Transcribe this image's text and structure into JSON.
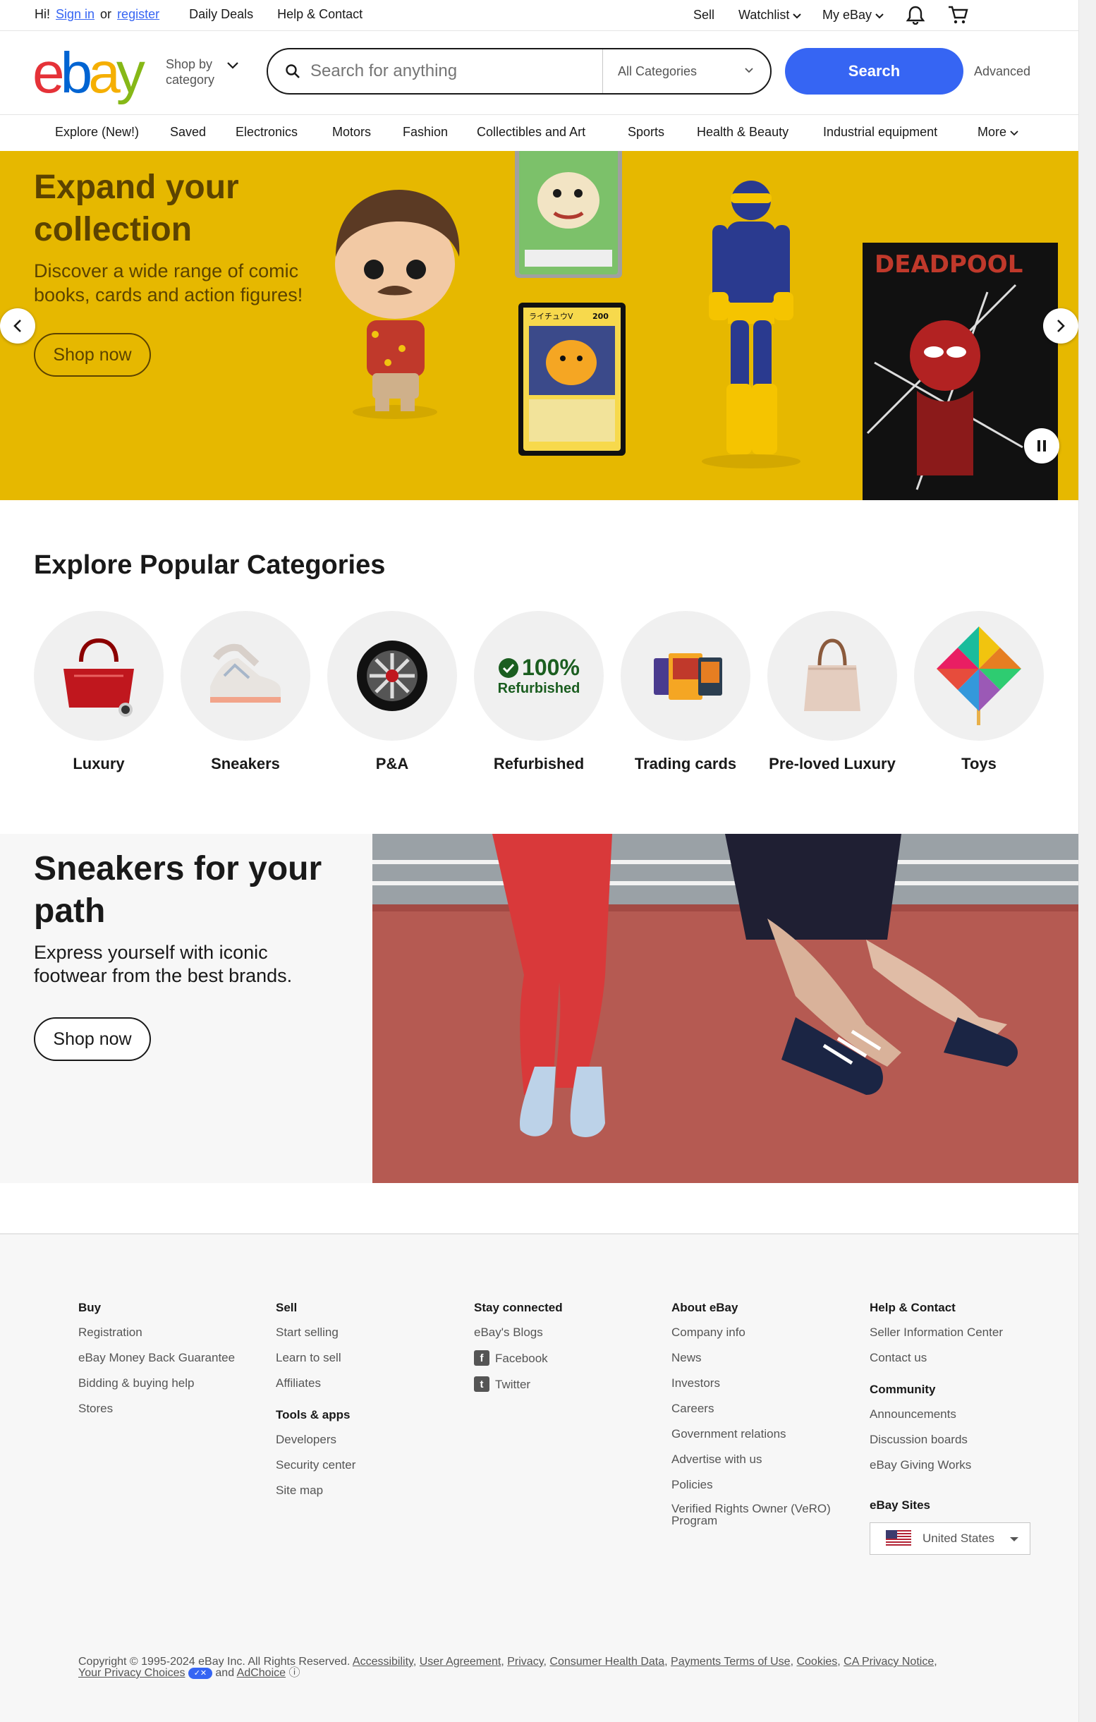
{
  "topbar": {
    "greeting": "Hi!",
    "sign_in": "Sign in",
    "or": "or",
    "register": "register",
    "daily_deals": "Daily Deals",
    "help_contact": "Help & Contact",
    "sell": "Sell",
    "watchlist": "Watchlist",
    "my_ebay": "My eBay",
    "notification_icon": "bell-icon",
    "cart_icon": "cart-icon"
  },
  "header": {
    "logo_letters": [
      "e",
      "b",
      "a",
      "y"
    ],
    "shop_by_category": "Shop by category",
    "search_placeholder": "Search for anything",
    "category_select": "All Categories",
    "search_button": "Search",
    "advanced": "Advanced"
  },
  "catnav": {
    "items": [
      "Explore (New!)",
      "Saved",
      "Electronics",
      "Motors",
      "Fashion",
      "Collectibles and Art",
      "Sports",
      "Health & Beauty",
      "Industrial equipment",
      "More"
    ]
  },
  "hero": {
    "title": "Expand your collection",
    "subtitle": "Discover a wide range of comic books, cards and action figures!",
    "cta": "Shop now",
    "bg_color": "#e6b800",
    "card_label_1": "ライチュウV",
    "card_hp": "200",
    "comic_title": "DEADPOOL"
  },
  "categories": {
    "title": "Explore Popular Categories",
    "items": [
      "Luxury",
      "Sneakers",
      "P&A",
      "Refurbished",
      "Trading cards",
      "Pre-loved Luxury",
      "Toys"
    ],
    "refurb_badge_pct": "100%",
    "refurb_badge_text": "Refurbished"
  },
  "sneakers": {
    "title": "Sneakers for your path",
    "subtitle": "Express yourself with iconic footwear from the best brands.",
    "cta": "Shop now"
  },
  "footer": {
    "buy": {
      "title": "Buy",
      "links": [
        "Registration",
        "eBay Money Back Guarantee",
        "Bidding & buying help",
        "Stores"
      ]
    },
    "sell": {
      "title": "Sell",
      "links": [
        "Start selling",
        "Learn to sell",
        "Affiliates"
      ]
    },
    "tools": {
      "title": "Tools & apps",
      "links": [
        "Developers",
        "Security center",
        "Site map"
      ]
    },
    "stay": {
      "title": "Stay connected",
      "links": [
        "eBay's Blogs"
      ],
      "facebook": "Facebook",
      "twitter": "Twitter"
    },
    "about": {
      "title": "About eBay",
      "links": [
        "Company info",
        "News",
        "Investors",
        "Careers",
        "Government relations",
        "Advertise with us",
        "Policies",
        "Verified Rights Owner (VeRO) Program"
      ]
    },
    "help": {
      "title": "Help & Contact",
      "links": [
        "Seller Information Center",
        "Contact us"
      ]
    },
    "community": {
      "title": "Community",
      "links": [
        "Announcements",
        "Discussion boards",
        "eBay Giving Works"
      ]
    },
    "sites": {
      "title": "eBay Sites",
      "country": "United States"
    },
    "copyright": "Copyright © 1995-2024 eBay Inc. All Rights Reserved.",
    "legal_links": [
      "Accessibility",
      "User Agreement",
      "Privacy",
      "Consumer Health Data",
      "Payments Terms of Use",
      "Cookies",
      "CA Privacy Notice"
    ],
    "privacy_choices": "Your Privacy Choices",
    "and": "and",
    "adchoice": "AdChoice"
  }
}
